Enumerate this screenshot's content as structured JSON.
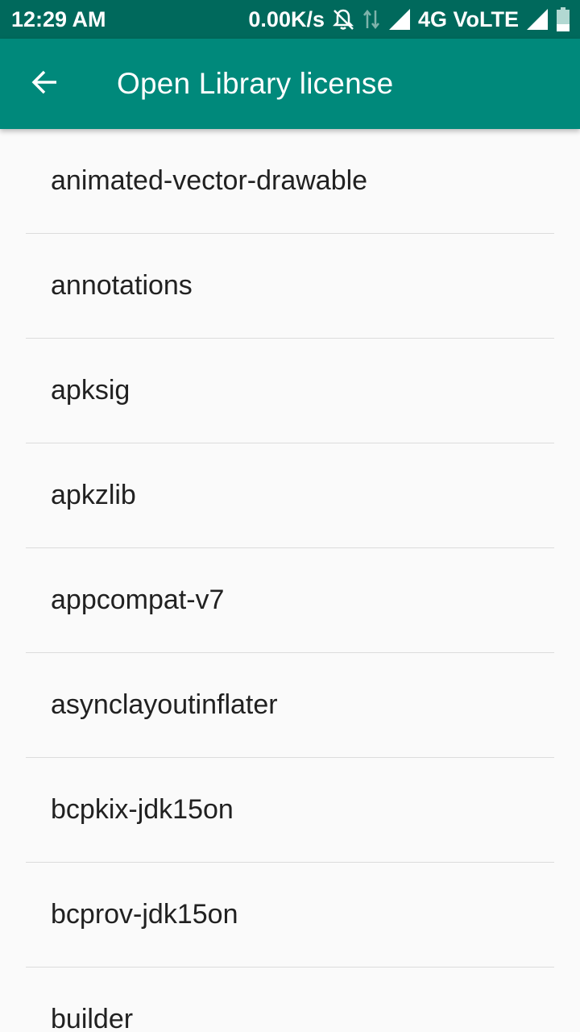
{
  "status_bar": {
    "time": "12:29 AM",
    "net_speed": "0.00K/s",
    "network": "4G VoLTE",
    "icons": [
      "mute-bell-icon",
      "data-arrows-icon",
      "signal-icon",
      "signal-icon",
      "battery-icon"
    ]
  },
  "app_bar": {
    "back_icon": "arrow-back-icon",
    "title": "Open Library license",
    "color": "#00897b",
    "status_color": "#00695c"
  },
  "libraries": [
    {
      "label": "animated-vector-drawable"
    },
    {
      "label": "annotations"
    },
    {
      "label": "apksig"
    },
    {
      "label": "apkzlib"
    },
    {
      "label": "appcompat-v7"
    },
    {
      "label": "asynclayoutinflater"
    },
    {
      "label": "bcpkix-jdk15on"
    },
    {
      "label": "bcprov-jdk15on"
    },
    {
      "label": "builder"
    }
  ]
}
